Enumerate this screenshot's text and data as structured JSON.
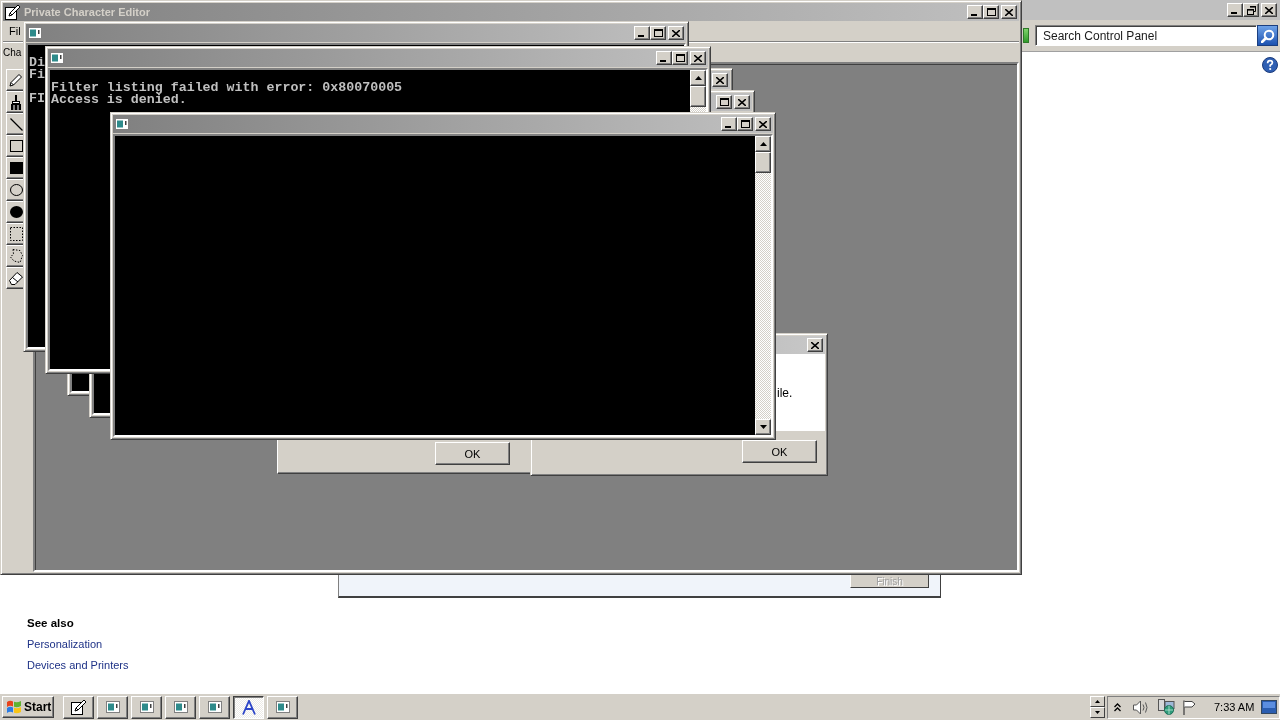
{
  "control_panel": {
    "search": {
      "placeholder": "Search Control Panel"
    },
    "see_also": {
      "title": "See also",
      "links": [
        "Personalization",
        "Devices and Printers"
      ]
    }
  },
  "wizard": {
    "button": {
      "label": "Finish",
      "disabled": true
    }
  },
  "editor": {
    "title": "Private Character Editor",
    "menu": [
      "Fil"
    ],
    "code_label": "Cha"
  },
  "consoles": [
    {
      "kind": "console",
      "output": "Di\nFi\n\nFI"
    },
    {
      "kind": "console",
      "output": "Filter listing failed with error: 0x80070005\nAccess is denied."
    },
    {
      "kind": "console"
    },
    {
      "kind": "console"
    },
    {
      "kind": "console"
    }
  ],
  "dialogs": [
    {
      "buttons": [
        "OK"
      ]
    },
    {
      "message": "ile.",
      "buttons": [
        "OK"
      ]
    }
  ],
  "taskbar": {
    "start": "Start",
    "buttons": [
      {
        "kind": "editor",
        "selected": false
      },
      {
        "kind": "console",
        "selected": false
      },
      {
        "kind": "console",
        "selected": false
      },
      {
        "kind": "console",
        "selected": false
      },
      {
        "kind": "console",
        "selected": false
      },
      {
        "kind": "font",
        "selected": true
      },
      {
        "kind": "console",
        "selected": false
      }
    ],
    "clock": "7:33 AM"
  }
}
